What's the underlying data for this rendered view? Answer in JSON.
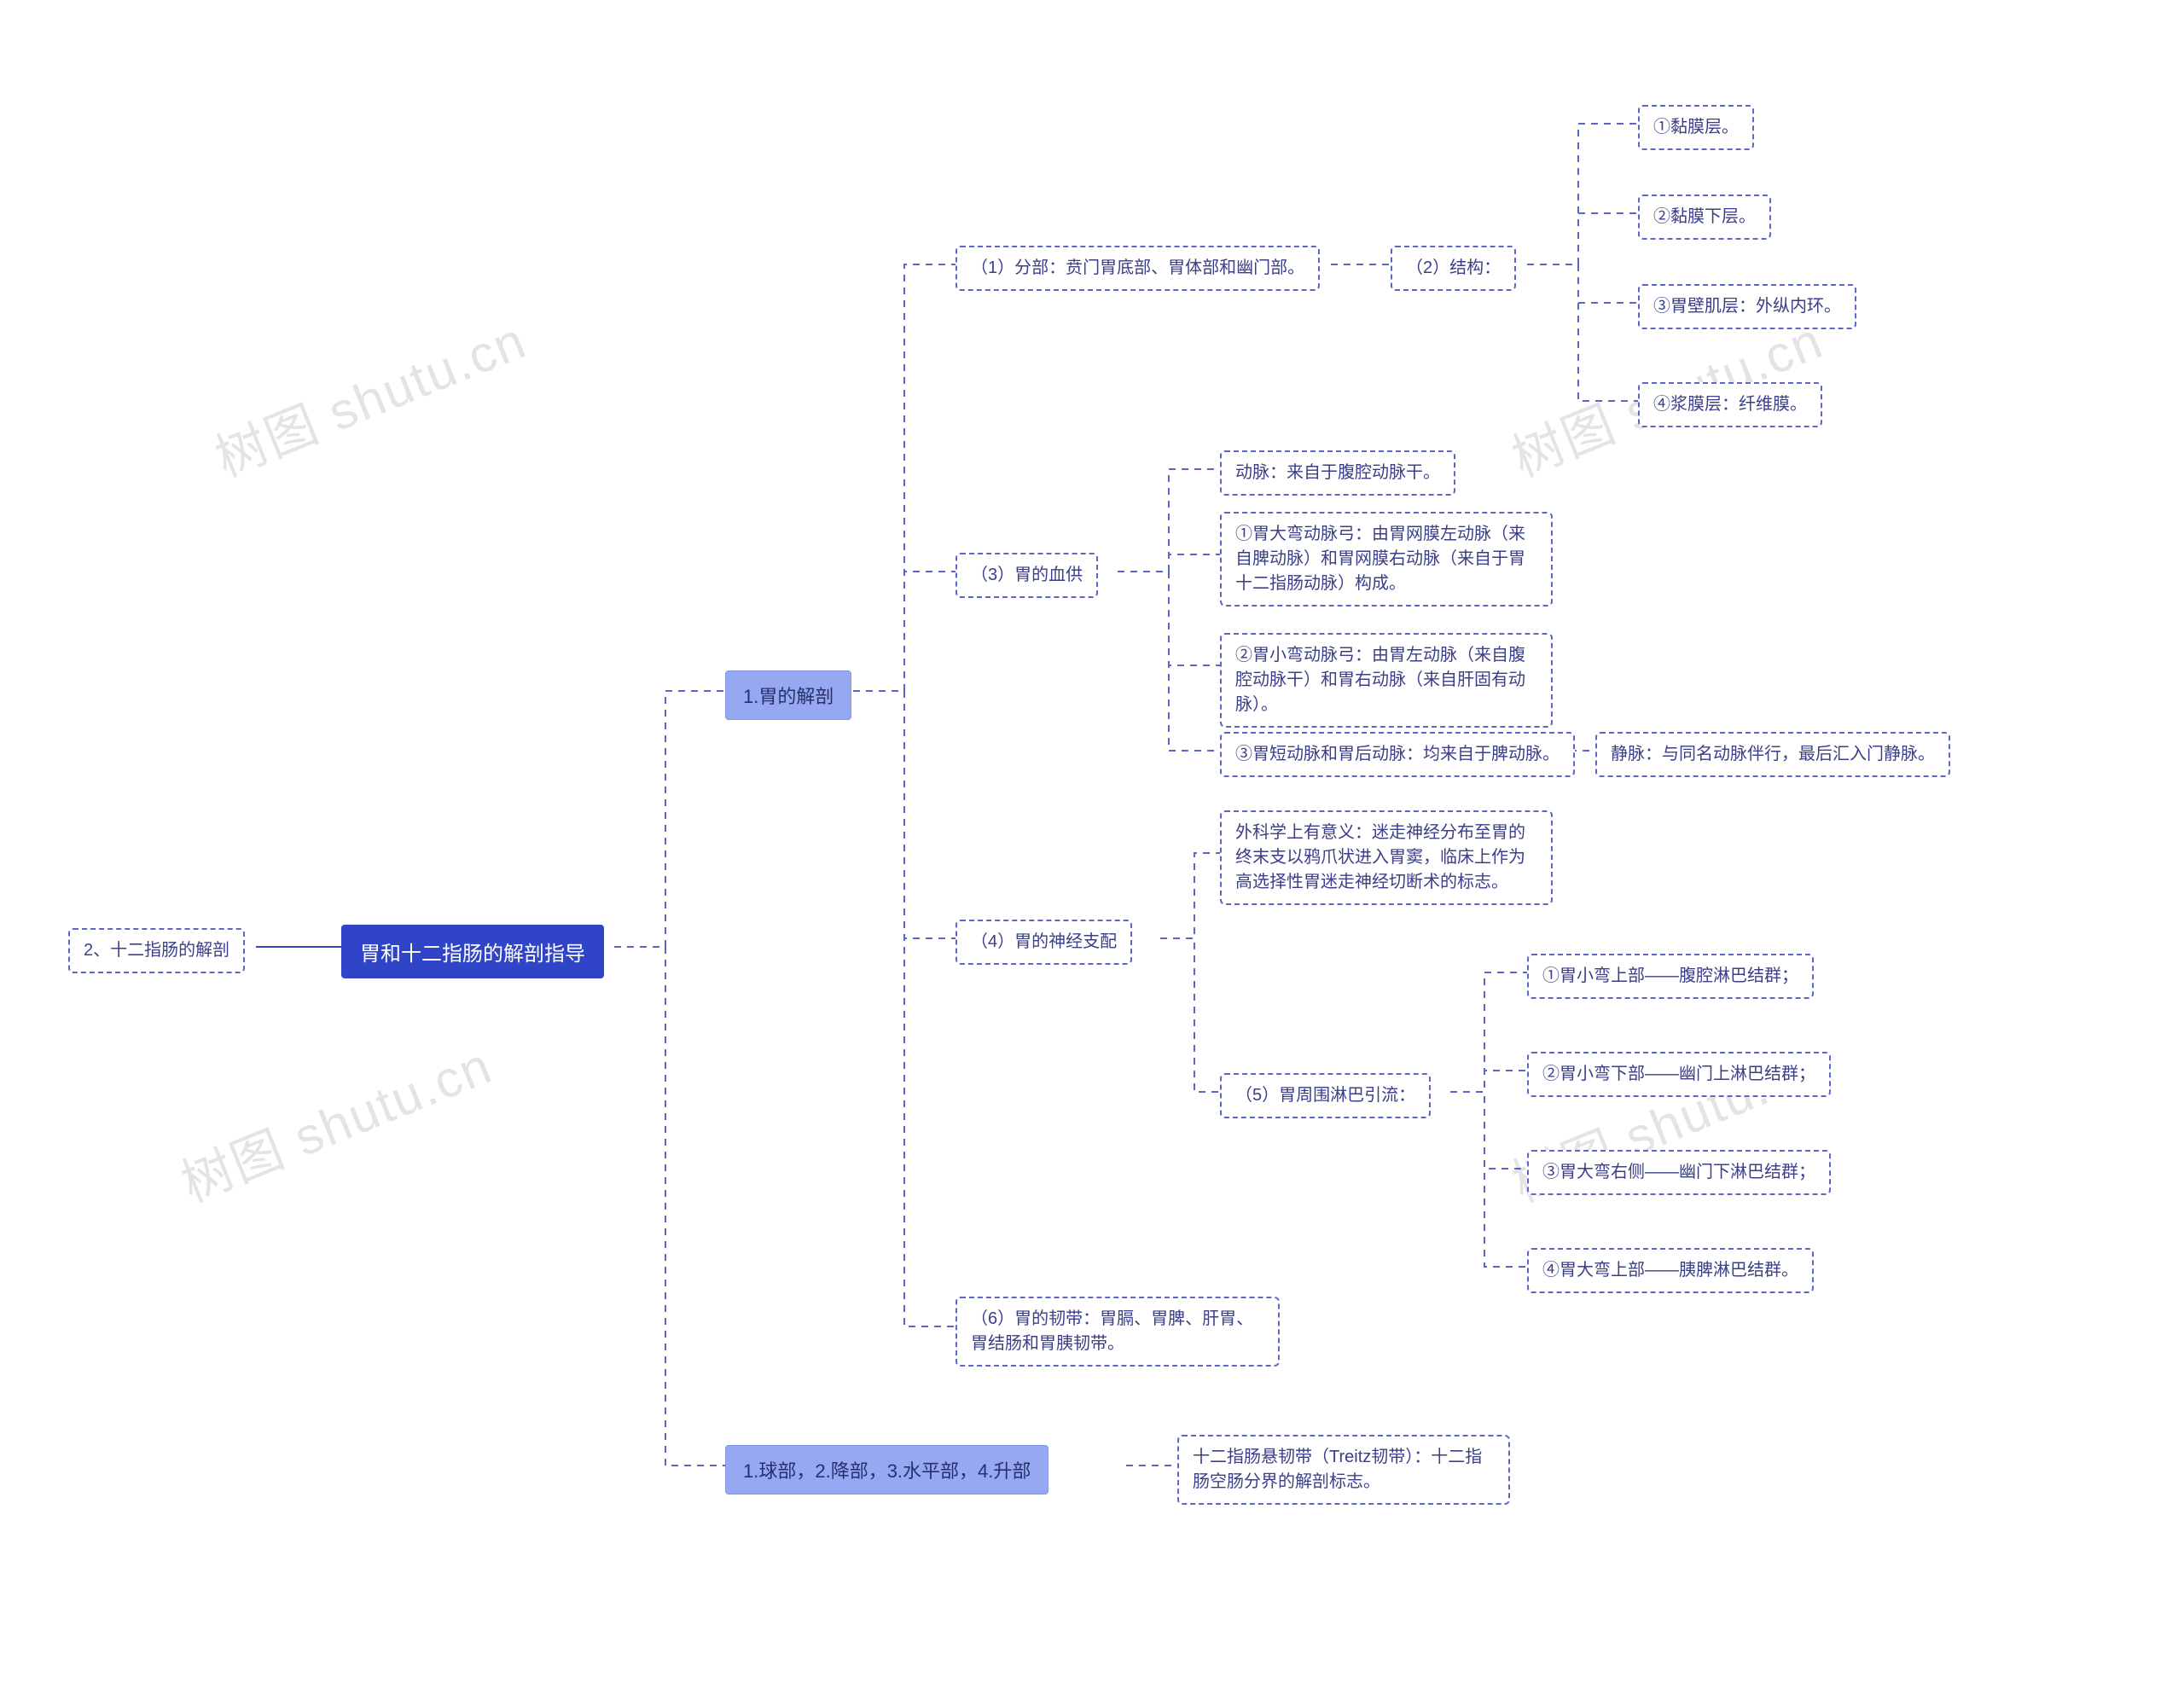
{
  "chart_data": {
    "type": "mindmap",
    "root": "胃和十二指肠的解剖指导",
    "left": [
      {
        "text": "2、十二指肠的解剖"
      }
    ],
    "right": [
      {
        "text": "1.胃的解剖",
        "children": [
          {
            "text": "（1）分部：贲门胃底部、胃体部和幽门部。",
            "children": [
              {
                "text": "（2）结构：",
                "children": [
                  {
                    "text": "①黏膜层。"
                  },
                  {
                    "text": "②黏膜下层。"
                  },
                  {
                    "text": "③胃壁肌层：外纵内环。"
                  },
                  {
                    "text": "④浆膜层：纤维膜。"
                  }
                ]
              }
            ]
          },
          {
            "text": "（3）胃的血供",
            "children": [
              {
                "text": "动脉：来自于腹腔动脉干。"
              },
              {
                "text": "①胃大弯动脉弓：由胃网膜左动脉（来自脾动脉）和胃网膜右动脉（来自于胃十二指肠动脉）构成。"
              },
              {
                "text": "②胃小弯动脉弓：由胃左动脉（来自腹腔动脉干）和胃右动脉（来自肝固有动脉）。"
              },
              {
                "text": "③胃短动脉和胃后动脉：均来自于脾动脉。",
                "children": [
                  {
                    "text": "静脉：与同名动脉伴行，最后汇入门静脉。"
                  }
                ]
              }
            ]
          },
          {
            "text": "（4）胃的神经支配",
            "children": [
              {
                "text": "外科学上有意义：迷走神经分布至胃的终末支以鸦爪状进入胃窦，临床上作为高选择性胃迷走神经切断术的标志。"
              },
              {
                "text": "（5）胃周围淋巴引流：",
                "children": [
                  {
                    "text": "①胃小弯上部——腹腔淋巴结群；"
                  },
                  {
                    "text": "②胃小弯下部——幽门上淋巴结群；"
                  },
                  {
                    "text": "③胃大弯右侧——幽门下淋巴结群；"
                  },
                  {
                    "text": "④胃大弯上部——胰脾淋巴结群。"
                  }
                ]
              }
            ]
          },
          {
            "text": "（6）胃的韧带：胃膈、胃脾、肝胃、胃结肠和胃胰韧带。"
          }
        ]
      },
      {
        "text": "1.球部，2.降部，3.水平部，4.升部",
        "children": [
          {
            "text": "十二指肠悬韧带（Treitz韧带）：十二指肠空肠分界的解剖标志。"
          }
        ]
      }
    ]
  },
  "watermarks": {
    "text": "树图 shutu.cn"
  },
  "root": "胃和十二指肠的解剖指导",
  "left0": "2、十二指肠的解剖",
  "r1": "1.胃的解剖",
  "r2": "1.球部，2.降部，3.水平部，4.升部",
  "s1": "（1）分部：贲门胃底部、胃体部和幽门部。",
  "s1b": "（2）结构：",
  "s1b1": "①黏膜层。",
  "s1b2": "②黏膜下层。",
  "s1b3": "③胃壁肌层：外纵内环。",
  "s1b4": "④浆膜层：纤维膜。",
  "s3": "（3）胃的血供",
  "s3a": "动脉：来自于腹腔动脉干。",
  "s3b": "①胃大弯动脉弓：由胃网膜左动脉（来自脾动脉）和胃网膜右动脉（来自于胃十二指肠动脉）构成。",
  "s3c": "②胃小弯动脉弓：由胃左动脉（来自腹腔动脉干）和胃右动脉（来自肝固有动脉）。",
  "s3d": "③胃短动脉和胃后动脉：均来自于脾动脉。",
  "s3dv": "静脉：与同名动脉伴行，最后汇入门静脉。",
  "s4": "（4）胃的神经支配",
  "s4a": "外科学上有意义：迷走神经分布至胃的终末支以鸦爪状进入胃窦，临床上作为高选择性胃迷走神经切断术的标志。",
  "s5": "（5）胃周围淋巴引流：",
  "s5a": "①胃小弯上部——腹腔淋巴结群；",
  "s5b": "②胃小弯下部——幽门上淋巴结群；",
  "s5c": "③胃大弯右侧——幽门下淋巴结群；",
  "s5d": "④胃大弯上部——胰脾淋巴结群。",
  "s6": "（6）胃的韧带：胃膈、胃脾、肝胃、胃结肠和胃胰韧带。",
  "r2a": "十二指肠悬韧带（Treitz韧带）：十二指肠空肠分界的解剖标志。"
}
